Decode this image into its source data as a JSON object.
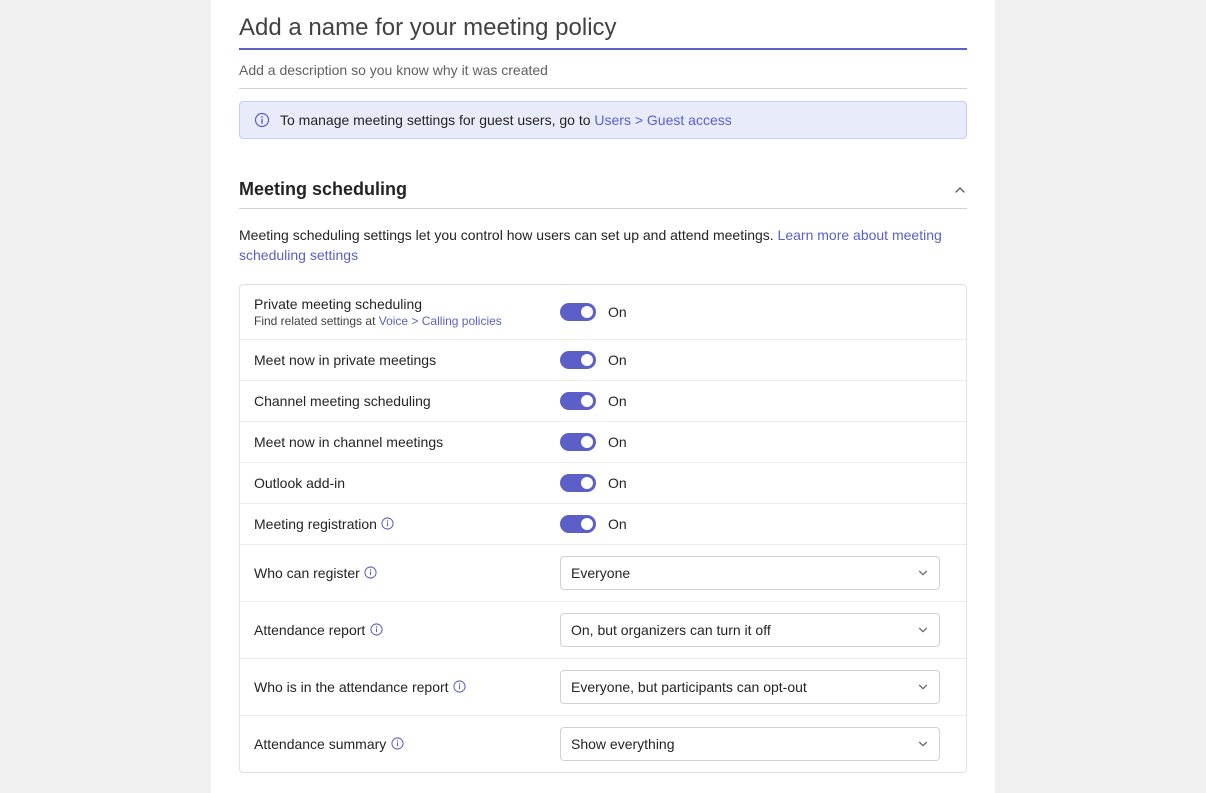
{
  "header": {
    "name_placeholder": "Add a name for your meeting policy",
    "description_placeholder": "Add a description so you know why it was created"
  },
  "banner": {
    "text": "To manage meeting settings for guest users, go to ",
    "link_text": "Users > Guest access"
  },
  "section": {
    "title": "Meeting scheduling",
    "desc_text": "Meeting scheduling settings let you control how users can set up and attend meetings. ",
    "desc_link": "Learn more about meeting scheduling settings"
  },
  "toggles": {
    "on_label": "On"
  },
  "rows": {
    "private_meeting": {
      "label": "Private meeting scheduling",
      "sub_prefix": "Find related settings at ",
      "sub_link": "Voice > Calling policies"
    },
    "meet_now_private": {
      "label": "Meet now in private meetings"
    },
    "channel_scheduling": {
      "label": "Channel meeting scheduling"
    },
    "meet_now_channel": {
      "label": "Meet now in channel meetings"
    },
    "outlook_addin": {
      "label": "Outlook add-in"
    },
    "meeting_registration": {
      "label": "Meeting registration"
    },
    "who_can_register": {
      "label": "Who can register",
      "value": "Everyone"
    },
    "attendance_report": {
      "label": "Attendance report",
      "value": "On, but organizers can turn it off"
    },
    "who_in_report": {
      "label": "Who is in the attendance report",
      "value": "Everyone, but participants can opt-out"
    },
    "attendance_summary": {
      "label": "Attendance summary",
      "value": "Show everything"
    }
  }
}
